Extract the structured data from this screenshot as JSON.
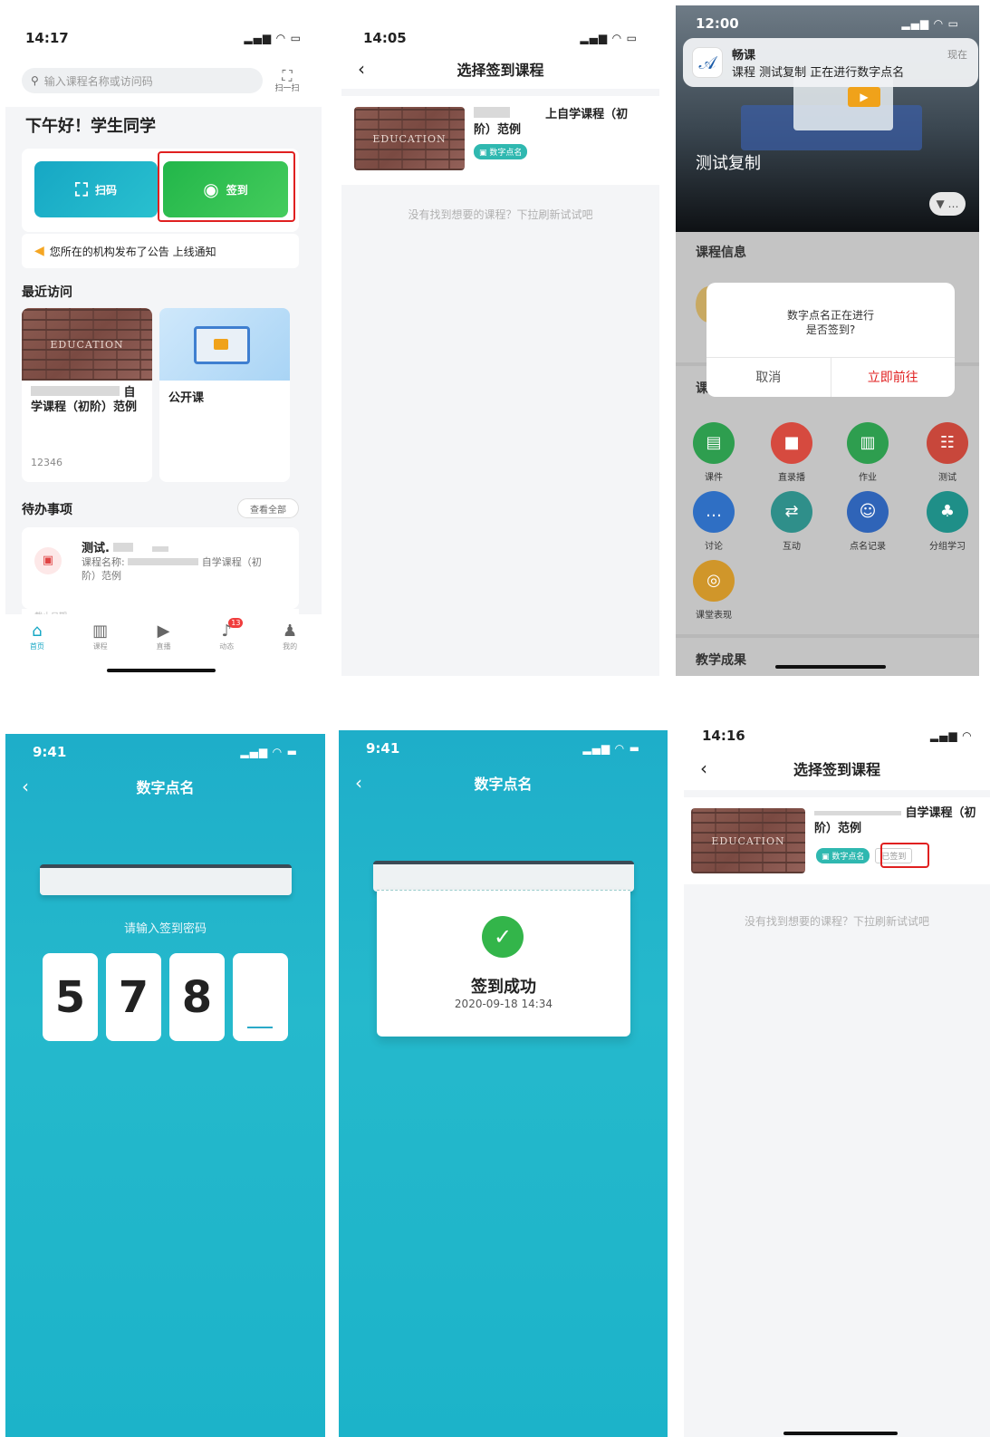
{
  "screen1": {
    "time": "14:17",
    "search_placeholder": "输入课程名称或访问码",
    "scan_label": "扫一扫",
    "greeting": "下午好！学生同学",
    "scan_button": "扫码",
    "checkin_button": "签到",
    "notice": "您所在的机构发布了公告 上线通知",
    "recent_title": "最近访问",
    "card1_image_text": "EDUCATION",
    "card1_title": "学课程（初阶）范例",
    "card1_title_prefix": "自",
    "card1_code": "12346",
    "card2_title": "公开课",
    "todo_title": "待办事项",
    "todo_view_all": "查看全部",
    "todo_item_title": "测试.",
    "todo_item_course_label": "课程名称:",
    "todo_item_course_tail": "自学课程（初",
    "todo_item_course_line2": "阶）范例",
    "todo_cutoff": "截止日期",
    "tabs": [
      "首页",
      "课程",
      "直播",
      "动态",
      "我的"
    ],
    "badge": "13"
  },
  "screen2": {
    "time": "14:05",
    "title": "选择签到课程",
    "image_text": "EDUCATION",
    "course_line1_tail": "上自学课程（初",
    "course_line2": "阶）范例",
    "tag": "数字点名",
    "empty": "没有找到想要的课程？下拉刷新试试吧"
  },
  "screen3": {
    "time": "12:00",
    "notif_app": "畅课",
    "notif_text": "课程 测试复制 正在进行数字点名",
    "notif_time": "现在",
    "course_name": "测试复制",
    "section_info": "课程信息",
    "dialog_line1": "数字点名正在进行",
    "dialog_line2": "是否签到?",
    "dialog_cancel": "取消",
    "dialog_confirm": "立即前往",
    "section_partial": "课",
    "grid": [
      {
        "label": "课件",
        "color": "#2e9e4f",
        "icon": "▤"
      },
      {
        "label": "直录播",
        "color": "#d64a3f",
        "icon": "■"
      },
      {
        "label": "作业",
        "color": "#2e9e4f",
        "icon": "▥"
      },
      {
        "label": "测试",
        "color": "#c8473b",
        "icon": "☷"
      },
      {
        "label": "讨论",
        "color": "#2f6fc4",
        "icon": "…"
      },
      {
        "label": "互动",
        "color": "#2f8f8a",
        "icon": "⇄"
      },
      {
        "label": "点名记录",
        "color": "#2f64b8",
        "icon": "☺"
      },
      {
        "label": "分组学习",
        "color": "#1f8f88",
        "icon": "♣"
      },
      {
        "label": "课堂表现",
        "color": "#d0962a",
        "icon": "◎"
      }
    ],
    "section_results": "教学成果"
  },
  "screen4": {
    "time": "9:41",
    "title": "数字点名",
    "prompt": "请输入签到密码",
    "digits": [
      "5",
      "7",
      "8",
      ""
    ]
  },
  "screen5": {
    "time": "9:41",
    "title": "数字点名",
    "success": "签到成功",
    "datetime": "2020-09-18 14:34"
  },
  "screen6": {
    "time": "14:16",
    "title": "选择签到课程",
    "image_text": "EDUCATION",
    "course_line1_tail": "自学课程（初",
    "course_line2": "阶）范例",
    "tag": "数字点名",
    "status": "已签到",
    "empty": "没有找到想要的课程？下拉刷新试试吧"
  },
  "colors": {
    "checkin_green": "#2fbf4f",
    "scan_teal": "#1ab0c7",
    "highlight_red": "#e02020",
    "primary_blue_bg": "#1eaec9"
  }
}
